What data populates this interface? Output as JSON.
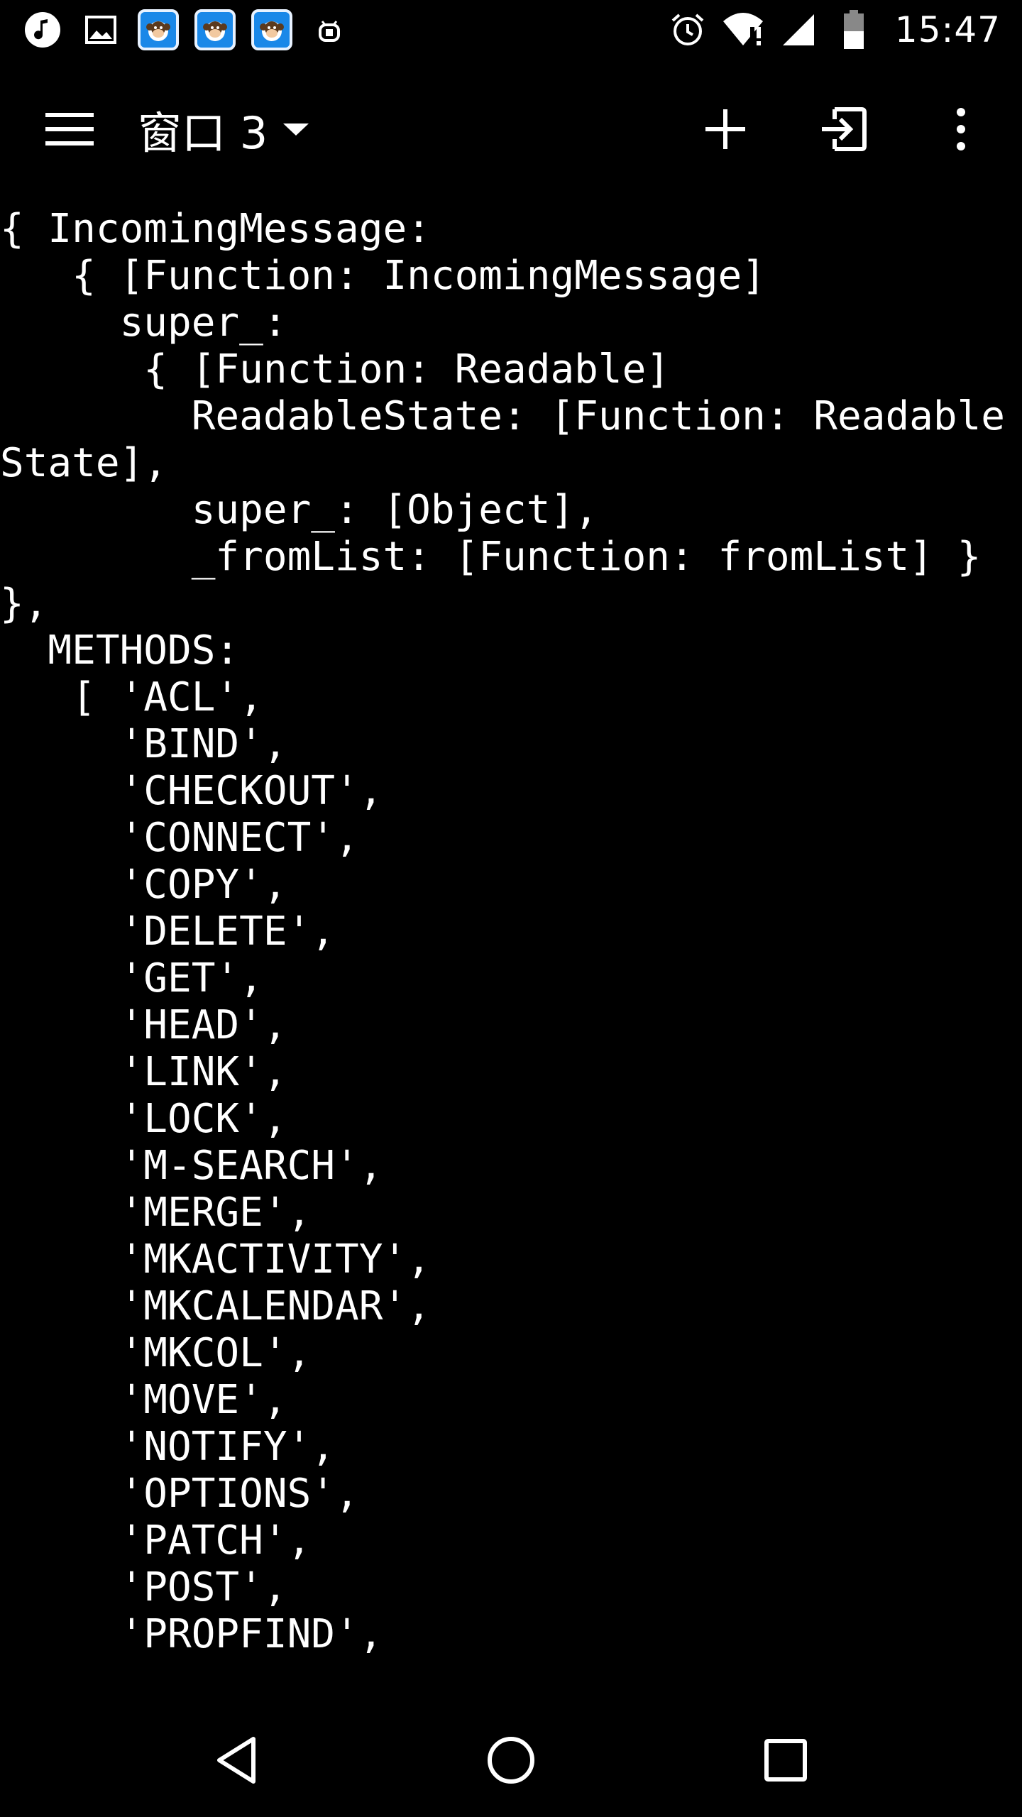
{
  "status_bar": {
    "time": "15:47",
    "left_icons": [
      "music-note-icon",
      "image-icon",
      "monkey-app-icon",
      "monkey-app-icon",
      "monkey-app-icon",
      "android-debug-icon"
    ],
    "right_icons": [
      "alarm-icon",
      "wifi-alert-icon",
      "cell-signal-icon",
      "battery-icon"
    ]
  },
  "toolbar": {
    "window_title": "窗口 3",
    "icons": [
      "menu-icon",
      "chevron-down-icon",
      "plus-icon",
      "enter-icon",
      "more-vertical-icon"
    ]
  },
  "terminal": {
    "lines": [
      "{ IncomingMessage:",
      "   { [Function: IncomingMessage]",
      "     super_:",
      "      { [Function: Readable]",
      "        ReadableState: [Function: Readable",
      "State],",
      "        super_: [Object],",
      "        _fromList: [Function: fromList] }",
      "},",
      "  METHODS:",
      "   [ 'ACL',",
      "     'BIND',",
      "     'CHECKOUT',",
      "     'CONNECT',",
      "     'COPY',",
      "     'DELETE',",
      "     'GET',",
      "     'HEAD',",
      "     'LINK',",
      "     'LOCK',",
      "     'M-SEARCH',",
      "     'MERGE',",
      "     'MKACTIVITY',",
      "     'MKCALENDAR',",
      "     'MKCOL',",
      "     'MOVE',",
      "     'NOTIFY',",
      "     'OPTIONS',",
      "     'PATCH',",
      "     'POST',",
      "     'PROPFIND',"
    ]
  },
  "nav_bar": {
    "icons": [
      "back-triangle-icon",
      "home-circle-icon",
      "recents-square-icon"
    ]
  },
  "colors": {
    "background": "#000000",
    "foreground": "#ffffff",
    "app_badge": "#1a88e8"
  }
}
